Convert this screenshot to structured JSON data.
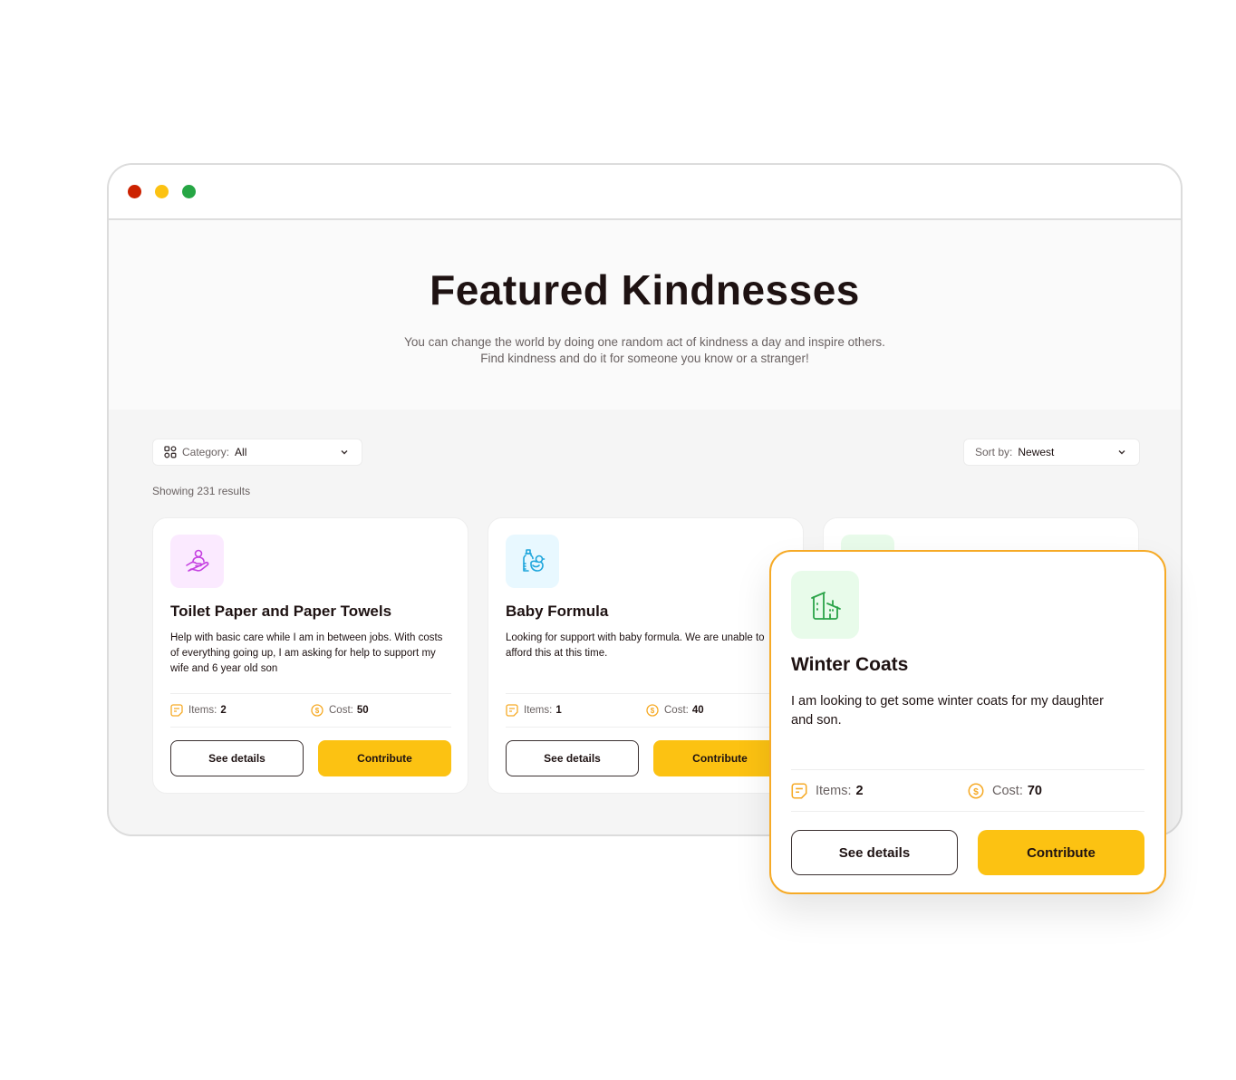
{
  "window": {
    "controls": [
      "close",
      "minimize",
      "maximize"
    ]
  },
  "hero": {
    "title": "Featured Kindnesses",
    "subtitle_line1": "You can change the world by doing one random act of kindness a day and inspire others.",
    "subtitle_line2": "Find kindness and do it for someone you know or a stranger!"
  },
  "filters": {
    "category_label": "Category:",
    "category_value": "All",
    "sort_label": "Sort by:",
    "sort_value": "Newest"
  },
  "results_text": "Showing 231 results",
  "colors": {
    "accent": "#fcc212",
    "highlight_border": "#f6aa26",
    "text_dark": "#1e1212",
    "text_muted": "#6a6262"
  },
  "cards": [
    {
      "icon": "hand-holding-person-icon",
      "icon_color": "#c43fe0",
      "icon_bg": "#fbeaff",
      "title": "Toilet Paper and Paper Towels",
      "description": "Help with basic care while I am in between jobs. With costs of everything going up, I am asking for help to support my wife and 6 year old son",
      "items_label": "Items:",
      "items_value": "2",
      "cost_label": "Cost:",
      "cost_value": "50",
      "see_details": "See details",
      "contribute": "Contribute"
    },
    {
      "icon": "baby-bottle-duck-icon",
      "icon_color": "#1ea6dc",
      "icon_bg": "#e8f8ff",
      "title": "Baby Formula",
      "description": "Looking for support with baby formula. We are unable to afford this at this time.",
      "items_label": "Items:",
      "items_value": "1",
      "cost_label": "Cost:",
      "cost_value": "40",
      "see_details": "See details",
      "contribute": "Contribute"
    },
    {
      "icon": "house-icon",
      "icon_color": "#2aa348",
      "icon_bg": "#e8fbea",
      "title": "Winter Coats",
      "description": "I am looking to get some winter coats for my daughter and son.",
      "items_label": "Items:",
      "items_value": "2",
      "cost_label": "Cost:",
      "cost_value": "70",
      "see_details": "See details",
      "contribute": "Contribute"
    }
  ]
}
